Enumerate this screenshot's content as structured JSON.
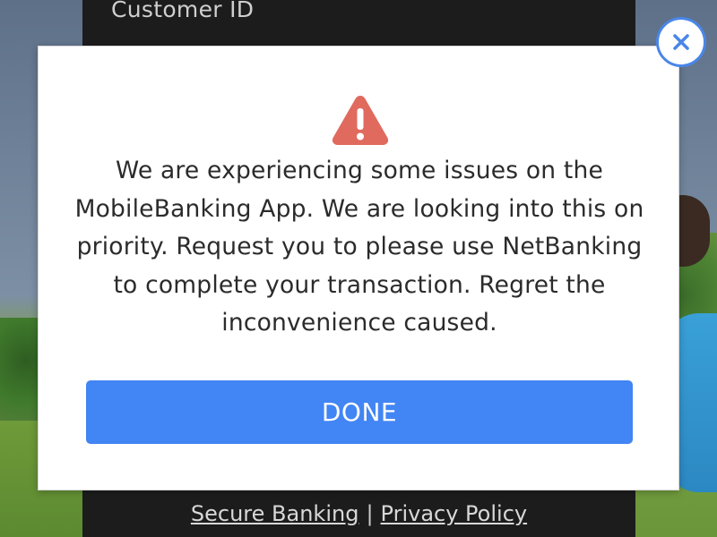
{
  "background": {
    "customer_id_label": "Customer ID"
  },
  "modal": {
    "icon": "warning-triangle-icon",
    "icon_color": "#e06a5e",
    "message": "We are experiencing some issues on the MobileBanking App. We are looking into this on priority. Request you to please use NetBanking to complete your transaction. Regret the inconvenience caused.",
    "done_label": "DONE",
    "done_color": "#4285f4",
    "close_icon": "close-x-icon",
    "close_color": "#4a86e8"
  },
  "footer": {
    "secure_banking": "Secure Banking",
    "separator": "|",
    "privacy_policy": "Privacy Policy"
  }
}
